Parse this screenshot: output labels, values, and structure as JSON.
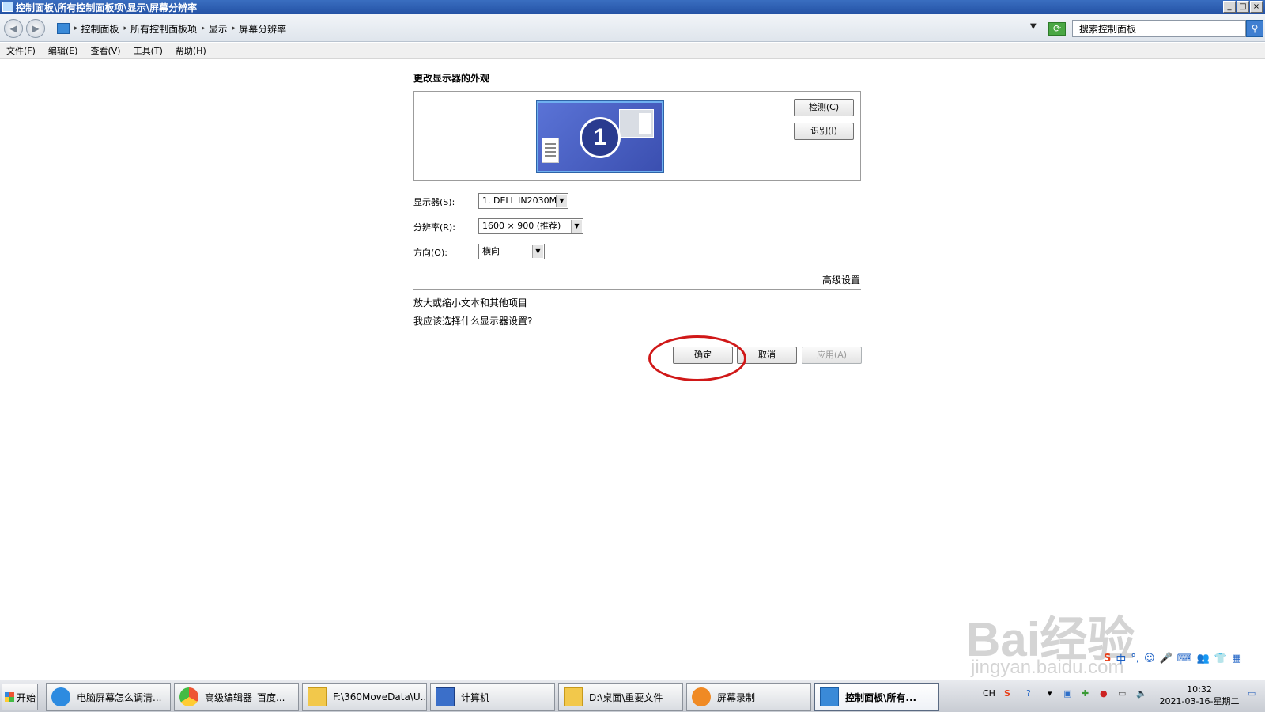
{
  "window": {
    "title": "控制面板\\所有控制面板项\\显示\\屏幕分辨率",
    "controls": [
      "_",
      "□",
      "×"
    ]
  },
  "address": {
    "breadcrumbs": [
      "控制面板",
      "所有控制面板项",
      "显示",
      "屏幕分辨率"
    ],
    "search_placeholder": "搜索控制面板"
  },
  "menu": [
    "文件(F)",
    "编辑(E)",
    "查看(V)",
    "工具(T)",
    "帮助(H)"
  ],
  "content": {
    "heading": "更改显示器的外观",
    "monitor_number": "1",
    "detect_button": "检测(C)",
    "identify_button": "识别(I)",
    "display_label": "显示器(S):",
    "display_value": "1. DELL IN2030M",
    "resolution_label": "分辨率(R):",
    "resolution_value": "1600 × 900 (推荐)",
    "orientation_label": "方向(O):",
    "orientation_value": "横向",
    "advanced_link": "高级设置",
    "link_text_size": "放大或缩小文本和其他项目",
    "link_which_settings": "我应该选择什么显示器设置?",
    "ok_button": "确定",
    "cancel_button": "取消",
    "apply_button": "应用(A)"
  },
  "taskbar": {
    "start": "开始",
    "tasks": [
      {
        "label": "电脑屏幕怎么调清...",
        "icon": "browser-icon"
      },
      {
        "label": "高级编辑器_百度...",
        "icon": "chrome-icon"
      },
      {
        "label": "F:\\360MoveData\\U...",
        "icon": "folder-icon"
      },
      {
        "label": "计算机",
        "icon": "computer-icon"
      },
      {
        "label": "D:\\桌面\\重要文件",
        "icon": "folder-icon"
      },
      {
        "label": "屏幕录制",
        "icon": "recorder-icon"
      },
      {
        "label": "控制面板\\所有...",
        "icon": "control-panel-icon"
      }
    ],
    "lang": "CH",
    "time": "10:32",
    "date": "2021-03-16-星期二"
  },
  "watermark": {
    "brand": "Bai经验",
    "url": "jingyan.baidu.com"
  },
  "ime": [
    "S",
    "中",
    "°,",
    "☺",
    "🎤",
    "⌨",
    "👥",
    "👕",
    "▦"
  ],
  "colors": {
    "titlebar": "#2452a5",
    "highlight_circle": "#d01818",
    "monitor": "#4a60c4"
  }
}
